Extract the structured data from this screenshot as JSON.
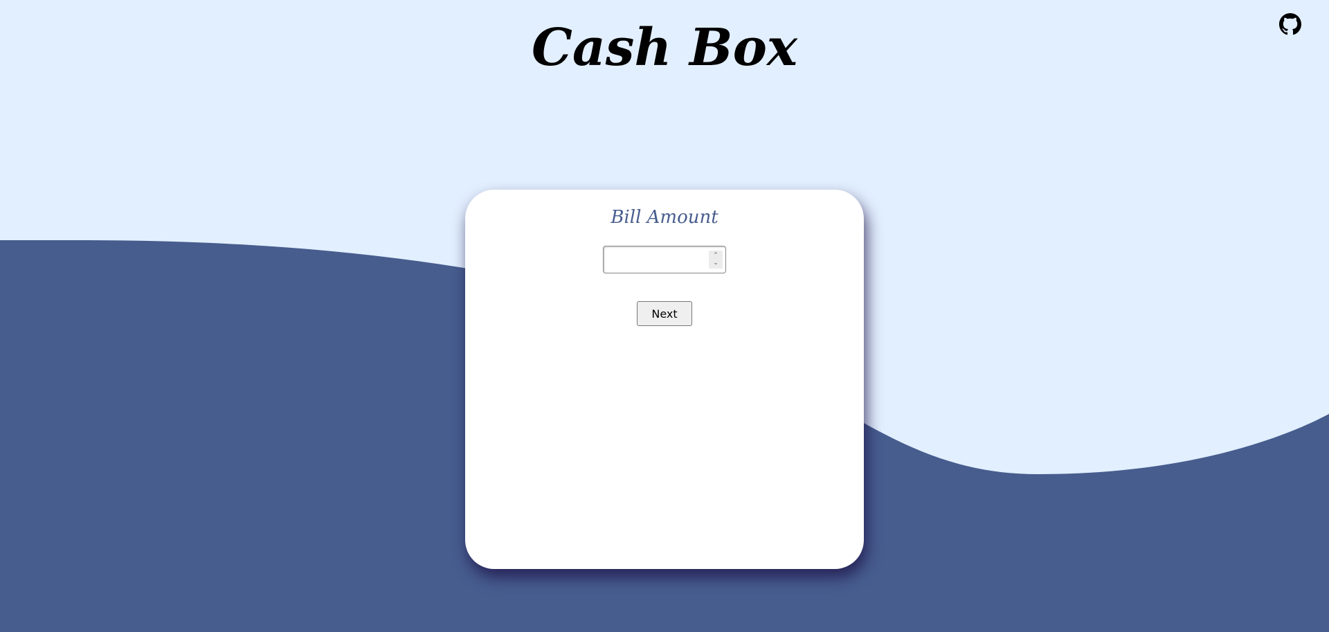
{
  "header": {
    "title": "Cash Box",
    "github_icon": "github-icon"
  },
  "card": {
    "heading": "Bill Amount",
    "amount_input": {
      "value": "",
      "placeholder": "",
      "type": "number"
    },
    "next_label": "Next"
  },
  "colors": {
    "background_light": "#e2effe",
    "wave_dark": "#475d8e",
    "card": "#ffffff",
    "heading_text": "#475d8e",
    "title_text": "#000000"
  }
}
